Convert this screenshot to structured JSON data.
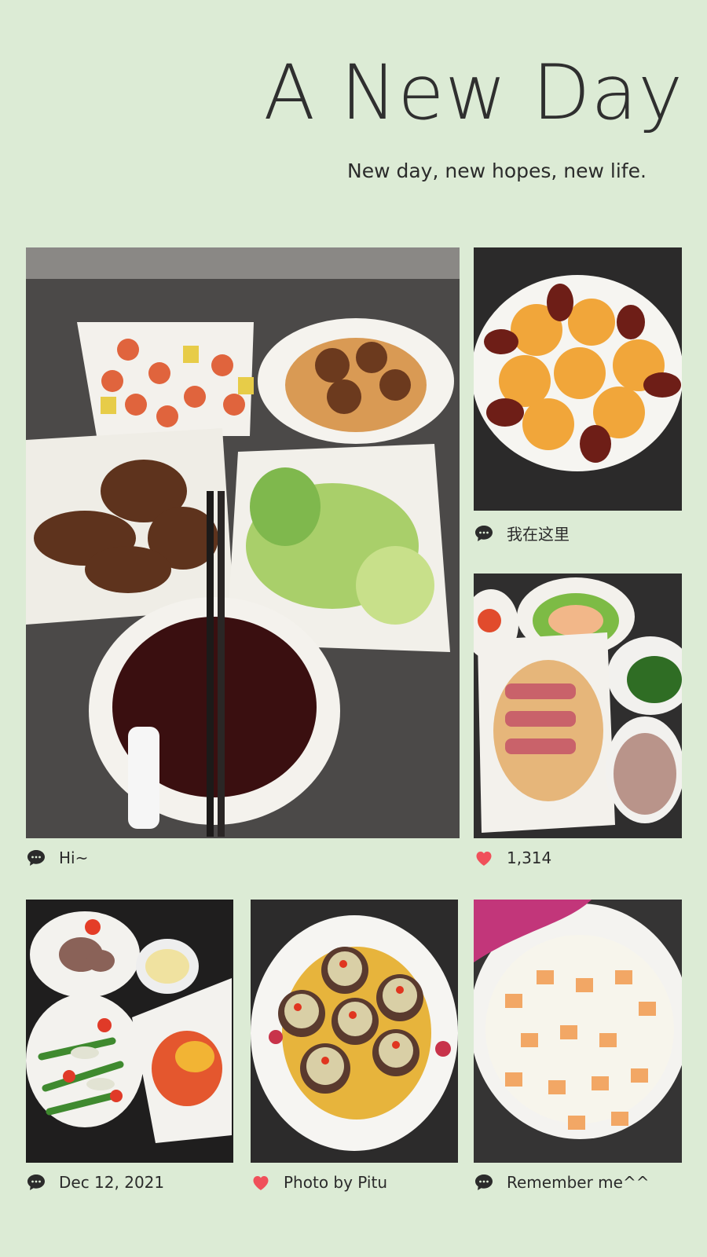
{
  "header": {
    "title": "A New Day",
    "subtitle": "New day, new hopes, new life."
  },
  "colors": {
    "background": "#dcebd5",
    "heart": "#f0505a",
    "text": "#2b2b2b"
  },
  "photos": [
    {
      "id": "main",
      "caption": "Hi~",
      "icon": "chat-icon"
    },
    {
      "id": "top-right",
      "caption": "我在这里",
      "icon": "chat-icon"
    },
    {
      "id": "mid-right",
      "caption": "1,314",
      "icon": "heart-icon"
    },
    {
      "id": "bottom-left",
      "caption": "Dec 12, 2021",
      "icon": "chat-icon"
    },
    {
      "id": "bottom-mid",
      "caption": "Photo by Pitu",
      "icon": "heart-icon"
    },
    {
      "id": "bottom-right",
      "caption": "Remember me^^",
      "icon": "chat-icon"
    }
  ]
}
